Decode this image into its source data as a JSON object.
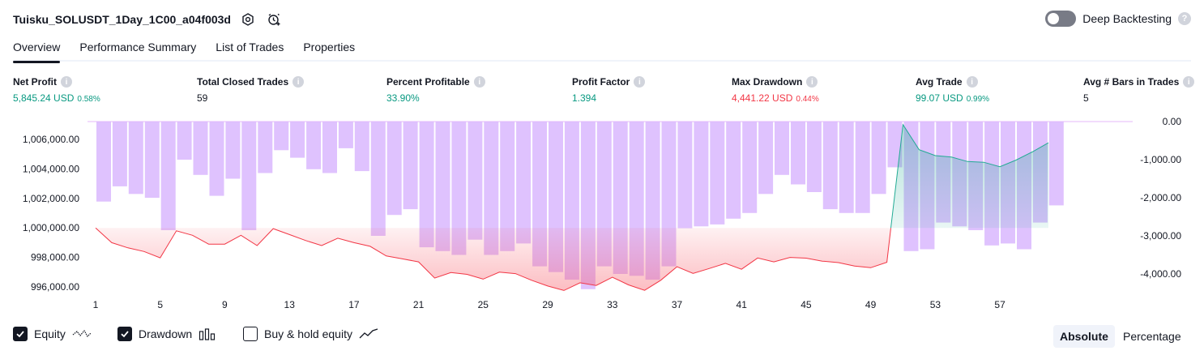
{
  "header": {
    "title": "Tuisku_SOLUSDT_1Day_1C00_a04f003d",
    "deep_backtesting_label": "Deep Backtesting",
    "deep_backtesting_on": false
  },
  "tabs": [
    {
      "label": "Overview",
      "active": true
    },
    {
      "label": "Performance Summary",
      "active": false
    },
    {
      "label": "List of Trades",
      "active": false
    },
    {
      "label": "Properties",
      "active": false
    }
  ],
  "metrics": [
    {
      "label": "Net Profit",
      "value": "5,845.24 USD",
      "pct": "0.58%",
      "tone": "pos"
    },
    {
      "label": "Total Closed Trades",
      "value": "59",
      "pct": "",
      "tone": "neu"
    },
    {
      "label": "Percent Profitable",
      "value": "33.90%",
      "pct": "",
      "tone": "pos"
    },
    {
      "label": "Profit Factor",
      "value": "1.394",
      "pct": "",
      "tone": "pos"
    },
    {
      "label": "Max Drawdown",
      "value": "4,441.22 USD",
      "pct": "0.44%",
      "tone": "neg"
    },
    {
      "label": "Avg Trade",
      "value": "99.07 USD",
      "pct": "0.99%",
      "tone": "pos"
    },
    {
      "label": "Avg # Bars in Trades",
      "value": "5",
      "pct": "",
      "tone": "neu"
    }
  ],
  "legend": {
    "equity": {
      "label": "Equity",
      "checked": true
    },
    "drawdown": {
      "label": "Drawdown",
      "checked": true
    },
    "buyhold": {
      "label": "Buy & hold equity",
      "checked": false
    }
  },
  "modes": {
    "absolute": "Absolute",
    "percentage": "Percentage",
    "active": "absolute"
  },
  "colors": {
    "equity_line_down": "#f23645",
    "equity_line_up": "#22ab94",
    "drawdown_bar": "#d8b4fe",
    "positive": "#089981",
    "negative": "#f23645"
  },
  "chart_data": {
    "type": "area",
    "x_ticks": [
      1,
      5,
      9,
      13,
      17,
      21,
      25,
      29,
      33,
      37,
      41,
      45,
      49,
      53,
      57
    ],
    "left_axis": {
      "ticks": [
        "1,006,000.00",
        "1,004,000.00",
        "1,002,000.00",
        "1,000,000.00",
        "998,000.00",
        "996,000.00"
      ],
      "tick_values": [
        1006000,
        1004000,
        1002000,
        1000000,
        998000,
        996000
      ],
      "baseline": 1000000
    },
    "right_axis": {
      "ticks": [
        "0.00",
        "-1,000.00",
        "-2,000.00",
        "-3,000.00",
        "-4,000.00"
      ],
      "tick_values": [
        0,
        -1000,
        -2000,
        -3000,
        -4000
      ]
    },
    "series": [
      {
        "key": "equity",
        "x": [
          1,
          2,
          3,
          4,
          5,
          6,
          7,
          8,
          9,
          10,
          11,
          12,
          13,
          14,
          15,
          16,
          17,
          18,
          19,
          20,
          21,
          22,
          23,
          24,
          25,
          26,
          27,
          28,
          29,
          30,
          31,
          32,
          33,
          34,
          35,
          36,
          37,
          38,
          39,
          40,
          41,
          42,
          43,
          44,
          45,
          46,
          47,
          48,
          49,
          50,
          51,
          52,
          53,
          54,
          55,
          56,
          57,
          58,
          59,
          60
        ],
        "values": [
          1000000,
          999000,
          998650,
          998400,
          997970,
          999800,
          999500,
          998900,
          998900,
          999500,
          998800,
          999950,
          999550,
          999150,
          998800,
          999300,
          999000,
          998750,
          998100,
          997900,
          997700,
          996600,
          996970,
          996850,
          996530,
          997000,
          996900,
          996450,
          996060,
          995760,
          996280,
          996100,
          996660,
          996140,
          995770,
          996450,
          997370,
          996920,
          997250,
          997600,
          997200,
          997960,
          997700,
          998000,
          997950,
          997750,
          997650,
          997420,
          997300,
          997670,
          1007000,
          1005300,
          1004900,
          1004800,
          1004500,
          1004450,
          1004150,
          1004600,
          1005150,
          1005770
        ]
      },
      {
        "key": "drawdown",
        "x": [
          1,
          2,
          3,
          4,
          5,
          6,
          7,
          8,
          9,
          10,
          11,
          12,
          13,
          14,
          15,
          16,
          17,
          18,
          19,
          20,
          21,
          22,
          23,
          24,
          25,
          26,
          27,
          28,
          29,
          30,
          31,
          32,
          33,
          34,
          35,
          36,
          37,
          38,
          39,
          40,
          41,
          42,
          43,
          44,
          45,
          46,
          47,
          48,
          49,
          50,
          51,
          52,
          53,
          54,
          55,
          56,
          57,
          58,
          59,
          60
        ],
        "values": [
          -2100,
          -1700,
          -1900,
          -2000,
          -2850,
          -1000,
          -1400,
          -1950,
          -1500,
          -2850,
          -1350,
          -750,
          -950,
          -1250,
          -1350,
          -700,
          -1300,
          -3000,
          -2450,
          -2300,
          -3300,
          -3400,
          -3500,
          -3100,
          -3500,
          -3400,
          -3200,
          -3800,
          -3950,
          -4150,
          -4400,
          -3800,
          -4000,
          -4050,
          -4150,
          -3800,
          -2800,
          -2750,
          -2700,
          -2550,
          -2400,
          -1900,
          -1400,
          -1650,
          -1850,
          -2300,
          -2400,
          -2400,
          -1900,
          -1200,
          -3400,
          -3350,
          -2650,
          -2750,
          -2850,
          -3250,
          -3200,
          -3350,
          -2650,
          -2200
        ]
      }
    ]
  }
}
